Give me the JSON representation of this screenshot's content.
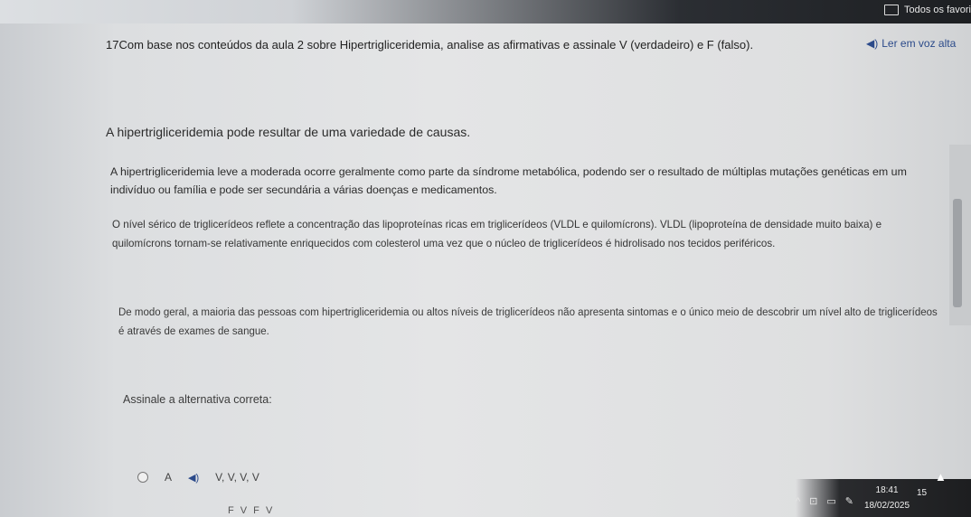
{
  "browser": {
    "favorites_label": "Todos os favori"
  },
  "toolbar": {
    "read_aloud_label": "Ler em voz alta"
  },
  "question": {
    "title": "17Com base nos conteúdos da aula 2 sobre Hipertrigliceridemia, analise as afirmativas e assinale V (verdadeiro) e F (falso).",
    "statements": [
      "A hipertrigliceridemia pode resultar de uma variedade de causas.",
      "A hipertrigliceridemia leve a moderada ocorre geralmente como parte da síndrome metabólica, podendo ser o resultado de múltiplas mutações genéticas em um indivíduo ou família e pode ser secundária a várias doenças e medicamentos.",
      "O nível sérico de triglicerídeos reflete a concentração das lipoproteínas ricas em triglicerídeos (VLDL e quilomícrons). VLDL (lipoproteína de densidade muito baixa) e quilomícrons tornam-se relativamente enriquecidos com colesterol uma vez que o núcleo de triglicerídeos é hidrolisado nos tecidos periféricos.",
      "De modo geral, a maioria das pessoas com hipertrigliceridemia ou altos níveis de triglicerídeos não apresenta sintomas e o único meio de descobrir um nível alto de triglicerídeos é através de exames de sangue."
    ],
    "instruction": "Assinale a alternativa correta:",
    "options": [
      {
        "letter": "A",
        "text": "V, V, V, V"
      },
      {
        "letter": "",
        "text": "F V F V"
      }
    ]
  },
  "taskbar": {
    "time": "18:41",
    "date": "18/02/2025",
    "notification_count": "15"
  }
}
